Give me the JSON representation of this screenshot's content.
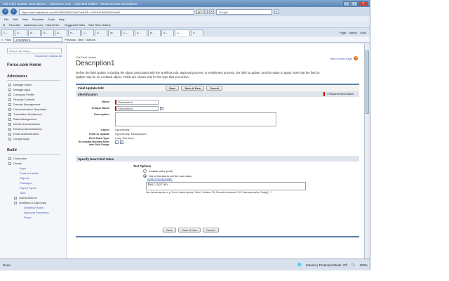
{
  "browser": {
    "title": "Edit Field Update: Description1 ~ salesforce.com - Unlimited Edition - Windows Internet Explorer",
    "url": "https://na8.salesforce.com/04Y8000000OxWJ?retURL=%2F04Y8000000OxWJ",
    "search_placeholder": "Google",
    "menu": [
      "File",
      "Edit",
      "View",
      "Favorites",
      "Tools",
      "Help"
    ],
    "favorites": [
      "Favorites",
      "salesforce.com - Tutorial Sa...",
      "Suggested Sites",
      "Web Slice Gallery"
    ],
    "tabs": [
      "C...",
      "S...",
      "A...",
      "S...",
      "D...",
      "H...",
      "C...",
      "S...",
      "W...",
      "C...",
      "E...",
      "B...",
      "S...",
      "C...",
      "F..."
    ],
    "commands": [
      "Page",
      "Safety",
      "Tools"
    ],
    "find": {
      "label": "Find:",
      "value": "description1",
      "previous": "Previous",
      "next": "Next",
      "options": "Options"
    },
    "status": {
      "left": "Done",
      "zone": "Internet | Protected Mode: Off",
      "zoom": "100%"
    }
  },
  "sidebar": {
    "search_placeholder": "Search All Setup...",
    "expand_link": "Expand All | Collapse All",
    "home": "Force.com Home",
    "administer_title": "Administer",
    "administer_items": [
      "Manage Users",
      "Manage Apps",
      "Company Profile",
      "Security Controls",
      "Domain Management",
      "Communication Templates",
      "Translation Workbench",
      "Data Management",
      "Mobile Administration",
      "Desktop Administration",
      "Email Administration",
      "Google Apps"
    ],
    "build_title": "Build",
    "build_items": [
      "Customize",
      "Create"
    ],
    "create_subitems": [
      "Apps",
      "Custom Labels",
      "Objects",
      "Packages",
      "Report Types",
      "Tabs",
      "Global Actions",
      "Workflow & Approvals"
    ],
    "workflow_subitems": [
      "Workflow Rules",
      "Approval Processes",
      "Flows"
    ]
  },
  "main": {
    "breadcrumb": "Edit Field Update",
    "title": "Description1",
    "help_link": "Help for this Page",
    "description": "Define the field update, including the object associated with the workflow rule, approval process, or entitlement process, the field to update, and the value to apply. Note that the field to update may be on a related object. Fields are shown only for the type that you select.",
    "edit_header": "Field Update Edit",
    "buttons": {
      "save": "Save",
      "save_new": "Save & New",
      "cancel": "Cancel"
    },
    "identification_title": "Identification",
    "required_note": "= Required Information",
    "fields": {
      "name_label": "Name",
      "name_value": "Description1",
      "unique_label": "Unique Name",
      "unique_value": "Description1",
      "description_label": "Description",
      "object_label": "Object",
      "object_value": "Opportunity",
      "field_label": "Field to Update",
      "field_value": "Opportunity: Description1",
      "datatype_label": "Field Data Type",
      "datatype_value": "Long Text Area",
      "reeval_label": "Re-evaluate Workflow Rules after Field Change"
    },
    "specify_title": "Specify New Field Value",
    "text_options_label": "Text Options",
    "radio_blank": "A blank value (null)",
    "radio_formula": "Use a formula to set the new value",
    "formula_editor_link": "Show Formula Editor",
    "formula_value": "Description",
    "formula_hint": "Use formula syntax, e.g. Text in double quotes: \"hello\", Number: 25, Percent as decimal: 0.10, Date expression: Today() + 7"
  }
}
